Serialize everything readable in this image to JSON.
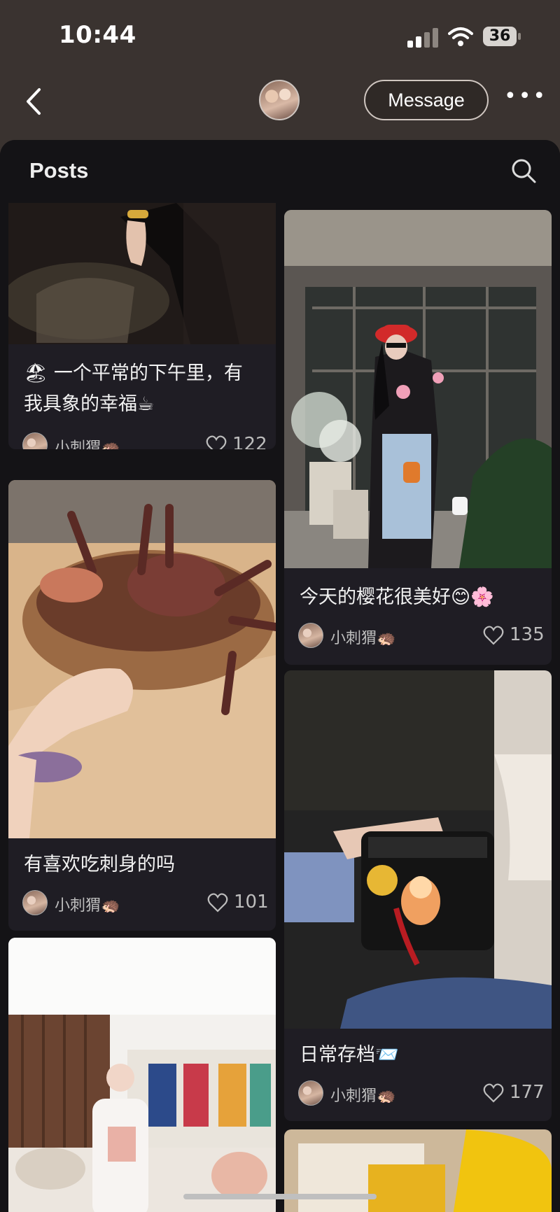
{
  "status_bar": {
    "time": "10:44",
    "battery": "36"
  },
  "nav": {
    "message_label": "Message",
    "more_label": "•••"
  },
  "panel": {
    "title": "Posts"
  },
  "posts": [
    {
      "caption": "🏖 一个平常的下午里，有\n我具象的幸福☕",
      "author": "小刺猬🦔",
      "likes": "122"
    },
    {
      "caption": "今天的樱花很美好😊🌸",
      "author": "小刺猬🦔",
      "likes": "135"
    },
    {
      "caption": "有喜欢吃刺身的吗",
      "author": "小刺猬🦔",
      "likes": "101"
    },
    {
      "caption": "日常存档📨",
      "author": "小刺猬🦔",
      "likes": "177"
    }
  ],
  "icons": [
    "back-chevron-icon",
    "signal-icon",
    "wifi-icon",
    "battery-icon",
    "search-icon",
    "heart-icon"
  ]
}
